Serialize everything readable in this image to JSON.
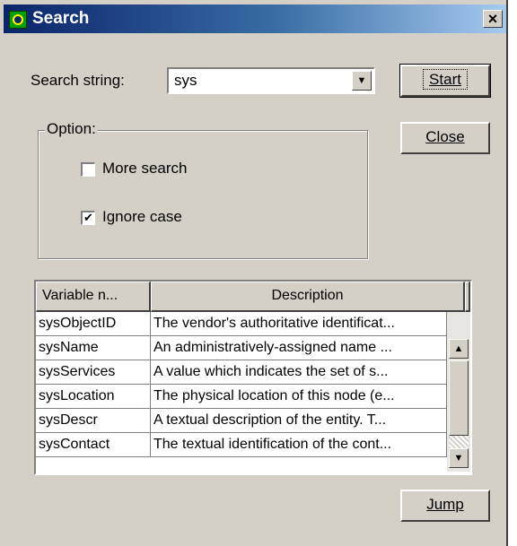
{
  "window": {
    "title": "Search",
    "close_glyph": "×"
  },
  "search": {
    "label": "Search string:",
    "value": "sys",
    "dropdown_icon": "chevron-down-icon"
  },
  "buttons": {
    "start": "Start",
    "close": "Close",
    "jump": "Jump"
  },
  "options": {
    "group_label": "Option:",
    "more_search": {
      "label": "More search",
      "checked": false
    },
    "ignore_case": {
      "label": "Ignore case",
      "checked": true
    }
  },
  "results": {
    "columns": [
      "Variable n...",
      "Description"
    ],
    "rows": [
      [
        "sysObjectID",
        "The vendor's authoritative identificat..."
      ],
      [
        "sysName",
        "An administratively-assigned name ..."
      ],
      [
        "sysServices",
        "A value which indicates the set of s..."
      ],
      [
        "sysLocation",
        "The physical location of this node (e..."
      ],
      [
        "sysDescr",
        "A textual description of the entity.  T..."
      ],
      [
        "sysContact",
        "The textual identification of the cont..."
      ]
    ]
  }
}
